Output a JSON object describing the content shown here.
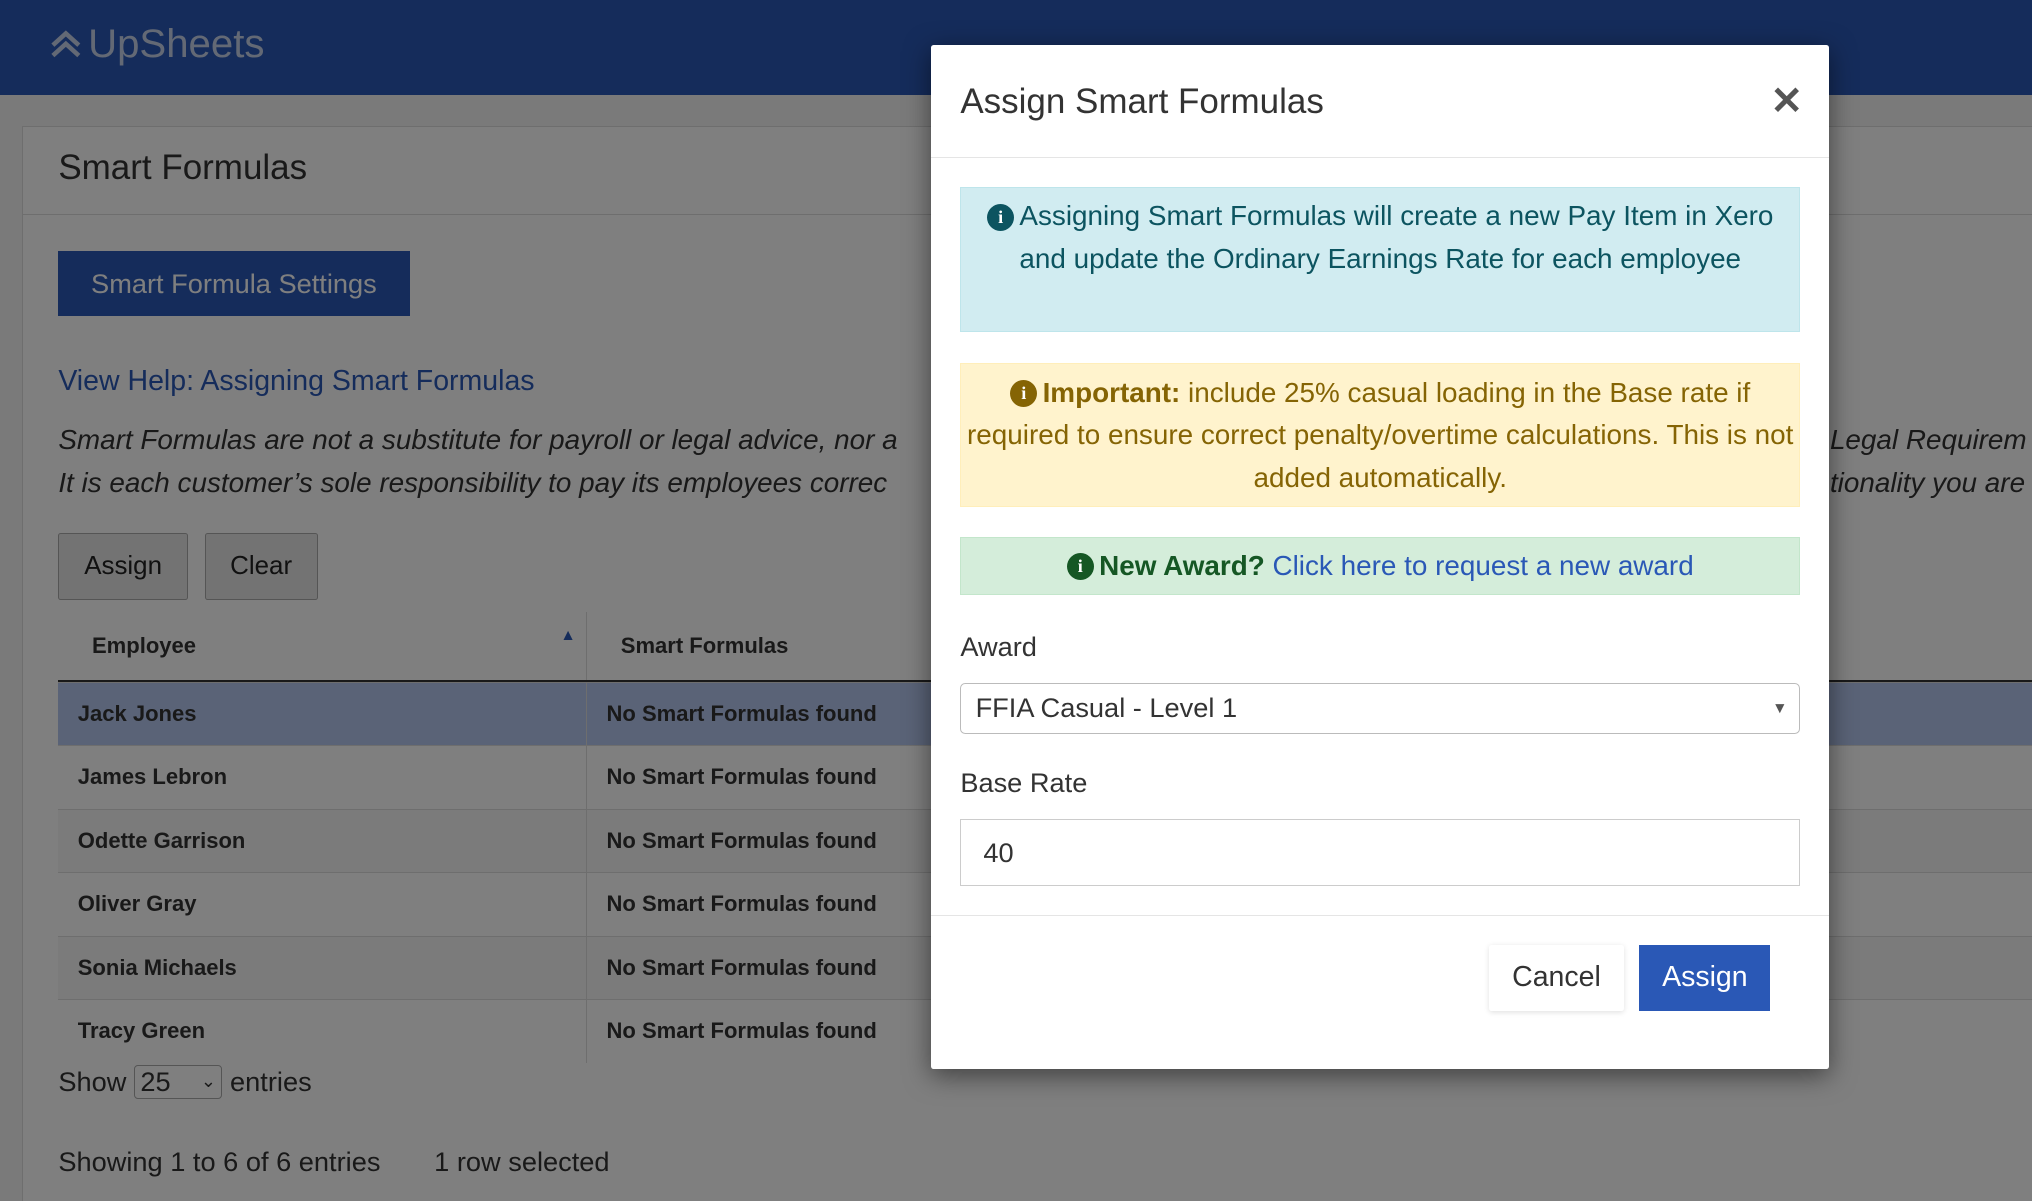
{
  "app": {
    "name": "UpSheets",
    "logo_icon": "double-chevron-up-icon"
  },
  "page": {
    "title": "Smart Formulas",
    "settings_button": "Smart Formula Settings",
    "help_link": "View Help: Assigning Smart Formulas",
    "disclaimer_line1_left": "Smart Formulas are not a substitute for payroll or legal advice, nor a",
    "disclaimer_line1_right": "Legal Requirem",
    "disclaimer_line2_left": "It is each customer’s sole responsibility to pay its employees correc",
    "disclaimer_line2_right": "tionality you are",
    "assign_button": "Assign",
    "clear_button": "Clear",
    "table": {
      "columns": [
        "Employee",
        "Smart Formulas"
      ],
      "rows": [
        {
          "employee": "Jack Jones",
          "formulas": "No Smart Formulas found",
          "selected": true
        },
        {
          "employee": "James Lebron",
          "formulas": "No Smart Formulas found"
        },
        {
          "employee": "Odette Garrison",
          "formulas": "No Smart Formulas found"
        },
        {
          "employee": "Oliver Gray",
          "formulas": "No Smart Formulas found"
        },
        {
          "employee": "Sonia Michaels",
          "formulas": "No Smart Formulas found"
        },
        {
          "employee": "Tracy Green",
          "formulas": "No Smart Formulas found"
        }
      ]
    },
    "show_label": "Show",
    "page_size": "25",
    "entries_label": "entries",
    "info": "Showing 1 to 6 of 6 entries",
    "selection": "1 row selected"
  },
  "modal": {
    "title": "Assign Smart Formulas",
    "info_text": "Assigning Smart Formulas will create a new Pay Item in Xero and update the Ordinary Earnings Rate for each employee",
    "warning_bold": "Important:",
    "warning_text": " include 25% casual loading in the Base rate if required to ensure correct penalty/overtime calculations. This is not added automatically.",
    "new_award_bold": "New Award?",
    "new_award_link": "Click here to request a new award",
    "award_label": "Award",
    "award_value": "FFIA Casual - Level 1",
    "base_rate_label": "Base Rate",
    "base_rate_value": "40",
    "cancel": "Cancel",
    "assign": "Assign"
  },
  "colors": {
    "brand": "#2a58b6",
    "info_bg": "#d1ecf1",
    "warning_bg": "#fff3cd",
    "success_bg": "#d4edda"
  }
}
